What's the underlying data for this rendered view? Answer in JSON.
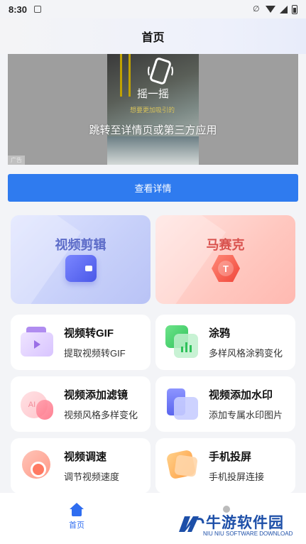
{
  "status_bar": {
    "time": "8:30"
  },
  "header": {
    "title": "首页"
  },
  "ad": {
    "shake_text": "摇一摇",
    "caption": "跳转至详情页或第三方应用",
    "photo_text": "想要更加吸引的",
    "tag": "广告"
  },
  "detail_button": {
    "label": "查看详情"
  },
  "big_cards": [
    {
      "label": "视频剪辑"
    },
    {
      "label": "马赛克",
      "icon_letter": "T"
    }
  ],
  "tools": [
    {
      "name": "视频转GIF",
      "desc": "提取视频转GIF"
    },
    {
      "name": "涂鸦",
      "desc": "多样风格涂鸦变化"
    },
    {
      "name": "视频添加滤镜",
      "desc": "视频风格多样变化",
      "icon_text": "AI"
    },
    {
      "name": "视频添加水印",
      "desc": "添加专属水印图片"
    },
    {
      "name": "视频调速",
      "desc": "调节视频速度"
    },
    {
      "name": "手机投屏",
      "desc": "手机投屏连接"
    }
  ],
  "tabbar": {
    "home_label": "首页"
  },
  "watermark": {
    "name": "牛游软件园",
    "sub": "NIU NIU SOFTWARE DOWNLOAD"
  },
  "colors": {
    "primary": "#2f7bef",
    "video_card": "#c6cff9",
    "mosaic_card": "#ffc7bf"
  }
}
